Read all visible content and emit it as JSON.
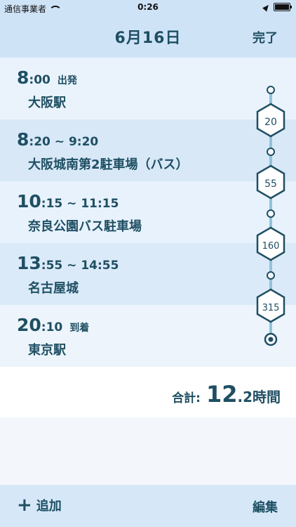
{
  "status": {
    "carrier": "通信事業者",
    "time": "0:26"
  },
  "header": {
    "title": "6月16日",
    "done_label": "完了"
  },
  "trips": [
    {
      "time_big": "8",
      "time_small": ":00",
      "tag": "出発",
      "place": "大阪駅"
    },
    {
      "time_big": "8",
      "time_small": ":20 ~ 9:20",
      "tag": "",
      "place": "大阪城南第2駐車場（バス）"
    },
    {
      "time_big": "10",
      "time_small": ":15 ~ 11:15",
      "tag": "",
      "place": "奈良公園バス駐車場"
    },
    {
      "time_big": "13",
      "time_small": ":55 ~ 14:55",
      "tag": "",
      "place": "名古屋城"
    },
    {
      "time_big": "20",
      "time_small": ":10",
      "tag": "到着",
      "place": "東京駅"
    }
  ],
  "legs": [
    "20",
    "55",
    "160",
    "315"
  ],
  "total": {
    "label": "合計:",
    "big": "12",
    "small": ".2時間"
  },
  "footer": {
    "add_label": "追加",
    "edit_label": "編集"
  },
  "colors": {
    "accent": "#1f4f63",
    "header_bg": "#cfe3f7"
  }
}
